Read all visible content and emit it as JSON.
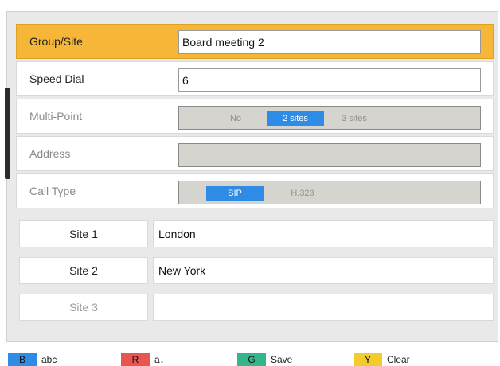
{
  "form": {
    "group_site": {
      "label": "Group/Site",
      "value": "Board meeting 2"
    },
    "speed_dial": {
      "label": "Speed Dial",
      "value": "6"
    },
    "multi_point": {
      "label": "Multi-Point",
      "options": [
        "No",
        "2 sites",
        "3 sites"
      ],
      "selected": "2 sites"
    },
    "address": {
      "label": "Address",
      "value": ""
    },
    "call_type": {
      "label": "Call Type",
      "options": [
        "SIP",
        "H.323"
      ],
      "selected": "SIP"
    }
  },
  "sites": [
    {
      "label": "Site 1",
      "value": "London"
    },
    {
      "label": "Site 2",
      "value": "New York"
    },
    {
      "label": "Site 3",
      "value": ""
    }
  ],
  "footer": {
    "keys": [
      {
        "key": "B",
        "label": "abc",
        "color": "#2f8ce6"
      },
      {
        "key": "R",
        "label": "a↓",
        "color": "#e8564f"
      },
      {
        "key": "G",
        "label": "Save",
        "color": "#36b58a"
      },
      {
        "key": "Y",
        "label": "Clear",
        "color": "#f2cb2c"
      }
    ]
  },
  "colors": {
    "selected_row": "#f6b738",
    "active_option": "#2f8ce6",
    "disabled_field": "#d6d4cf"
  }
}
